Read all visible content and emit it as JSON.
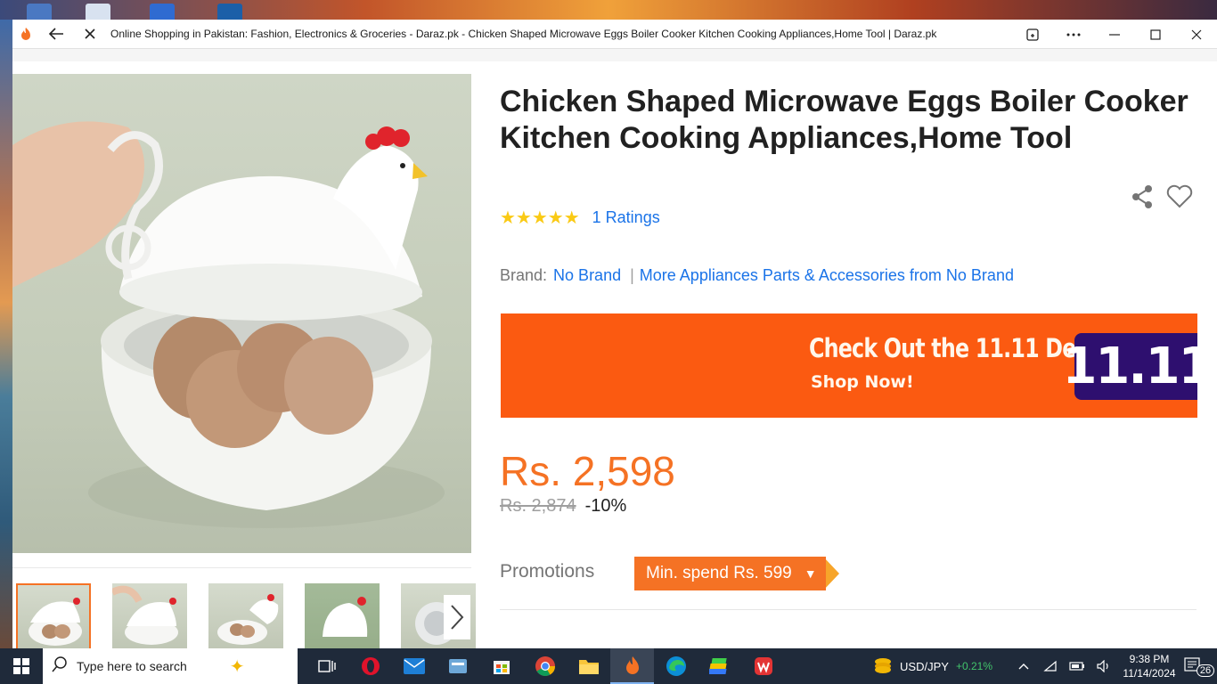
{
  "browser": {
    "tab_title": "Online Shopping in Pakistan: Fashion, Electronics & Groceries - Daraz.pk - Chicken Shaped Microwave Eggs Boiler Cooker Kitchen Cooking Appliances,Home Tool | Daraz.pk"
  },
  "product": {
    "title": "Chicken Shaped Microwave Eggs Boiler Cooker Kitchen Cooking Appliances,Home Tool",
    "stars": "★★★★★",
    "rating_value": 5,
    "ratings_link": "1 Ratings",
    "brand_label": "Brand:",
    "brand_name": "No Brand",
    "brand_separator": "|",
    "more_from_brand": "More Appliances Parts & Accessories from No Brand",
    "price": "Rs. 2,598",
    "old_price": "Rs. 2,874",
    "discount": "-10%",
    "promotions_label": "Promotions",
    "promotion_chip": "Min. spend Rs. 599"
  },
  "banner": {
    "headline": "Check Out the 11.11 Deals",
    "cta": "Shop Now!",
    "badge": "11.11"
  },
  "taskbar": {
    "search_placeholder": "Type here to search",
    "ticker_symbol": "USD/JPY",
    "ticker_change": "+0.21%",
    "time": "9:38 PM",
    "date": "11/14/2024",
    "notification_count": "26"
  },
  "colors": {
    "accent_orange": "#f57224",
    "link_blue": "#1a73e8",
    "star_yellow": "#faca15",
    "banner_orange": "#fb5a11",
    "badge_purple": "#2e0f6f"
  }
}
